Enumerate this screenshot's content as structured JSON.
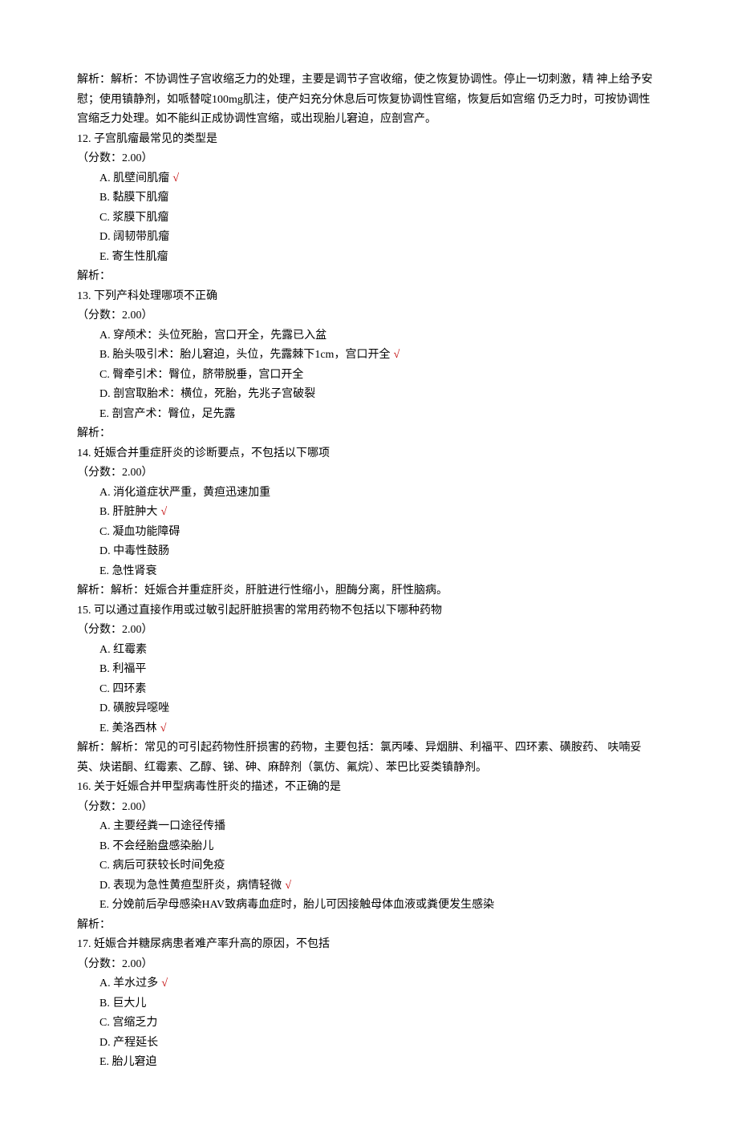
{
  "pre_analysis": "解析：解析：不协调性子宫收缩乏力的处理，主要是调节子宫收缩，使之恢复协调性。停止一切刺激，精 神上给予安慰；使用镇静剂，如哌替啶100mg肌注，使产妇充分休息后可恢复协调性官缩，恢复后如宫缩 仍乏力时，可按协调性宫缩乏力处理。如不能纠正成协调性宫缩，或出现胎儿窘迫，应剖宫产。",
  "mark": "√",
  "questions": [
    {
      "num": "12.",
      "text": "子宫肌瘤最常见的类型是",
      "score": "（分数：2.00）",
      "options": [
        {
          "letter": "A.",
          "text": "肌壁间肌瘤",
          "correct": true
        },
        {
          "letter": "B.",
          "text": "黏膜下肌瘤",
          "correct": false
        },
        {
          "letter": "C.",
          "text": "浆膜下肌瘤",
          "correct": false
        },
        {
          "letter": "D.",
          "text": "阔韧带肌瘤",
          "correct": false
        },
        {
          "letter": "E.",
          "text": "寄生性肌瘤",
          "correct": false
        }
      ],
      "analysis": "解析："
    },
    {
      "num": "13.",
      "text": "下列产科处理哪项不正确",
      "score": "（分数：2.00）",
      "options": [
        {
          "letter": "A.",
          "text": "穿颅术：头位死胎，宫口开全，先露已入盆",
          "correct": false
        },
        {
          "letter": "B.",
          "text": "胎头吸引术：胎儿窘迫，头位，先露棘下1cm，宫口开全",
          "correct": true
        },
        {
          "letter": "C.",
          "text": "臀牵引术：臀位，脐带脱垂，宫口开全",
          "correct": false
        },
        {
          "letter": "D.",
          "text": "剖宫取胎术：横位，死胎，先兆子宫破裂",
          "correct": false
        },
        {
          "letter": "E.",
          "text": "剖宫产术：臀位，足先露",
          "correct": false
        }
      ],
      "analysis": "解析："
    },
    {
      "num": "14.",
      "text": "妊娠合并重症肝炎的诊断要点，不包括以下哪项",
      "score": "（分数：2.00）",
      "options": [
        {
          "letter": "A.",
          "text": "消化道症状严重，黄疸迅速加重",
          "correct": false
        },
        {
          "letter": "B.",
          "text": "肝脏肿大",
          "correct": true
        },
        {
          "letter": "C.",
          "text": "凝血功能障碍",
          "correct": false
        },
        {
          "letter": "D.",
          "text": "中毒性鼓肠",
          "correct": false
        },
        {
          "letter": "E.",
          "text": "急性肾衰",
          "correct": false
        }
      ],
      "analysis": "解析：解析：妊娠合并重症肝炎，肝脏进行性缩小，胆酶分离，肝性脑病。"
    },
    {
      "num": "15.",
      "text": "可以通过直接作用或过敏引起肝脏损害的常用药物不包括以下哪种药物",
      "score": "（分数：2.00）",
      "options": [
        {
          "letter": "A.",
          "text": "红霉素",
          "correct": false
        },
        {
          "letter": "B.",
          "text": "利福平",
          "correct": false
        },
        {
          "letter": "C.",
          "text": "四环素",
          "correct": false
        },
        {
          "letter": "D.",
          "text": "磺胺异噁唑",
          "correct": false
        },
        {
          "letter": "E.",
          "text": "美洛西林",
          "correct": true
        }
      ],
      "analysis": "解析：解析：常见的可引起药物性肝损害的药物，主要包括：氯丙嗪、异烟肼、利福平、四环素、磺胺药、 呋喃妥英、炔诺酮、红霉素、乙醇、锑、砷、麻醉剂（氯仿、氟烷）、苯巴比妥类镇静剂。"
    },
    {
      "num": "16.",
      "text": "关于妊娠合并甲型病毒性肝炎的描述，不正确的是",
      "score": "（分数：2.00）",
      "options": [
        {
          "letter": "A.",
          "text": "主要经粪一口途径传播",
          "correct": false
        },
        {
          "letter": "B.",
          "text": "不会经胎盘感染胎儿",
          "correct": false
        },
        {
          "letter": "C.",
          "text": "病后可获较长时间免疫",
          "correct": false
        },
        {
          "letter": "D.",
          "text": "表现为急性黄疸型肝炎，病情轻微",
          "correct": true
        },
        {
          "letter": "E.",
          "text": "分娩前后孕母感染HAV致病毒血症时，胎儿可因接触母体血液或粪便发生感染",
          "correct": false
        }
      ],
      "analysis": "解析："
    },
    {
      "num": "17.",
      "text": "妊娠合并糖尿病患者难产率升高的原因，不包括",
      "score": "（分数：2.00）",
      "options": [
        {
          "letter": "A.",
          "text": "羊水过多",
          "correct": true
        },
        {
          "letter": "B.",
          "text": "巨大儿",
          "correct": false
        },
        {
          "letter": "C.",
          "text": "宫缩乏力",
          "correct": false
        },
        {
          "letter": "D.",
          "text": "产程延长",
          "correct": false
        },
        {
          "letter": "E.",
          "text": "胎儿窘迫",
          "correct": false
        }
      ],
      "analysis": ""
    }
  ]
}
